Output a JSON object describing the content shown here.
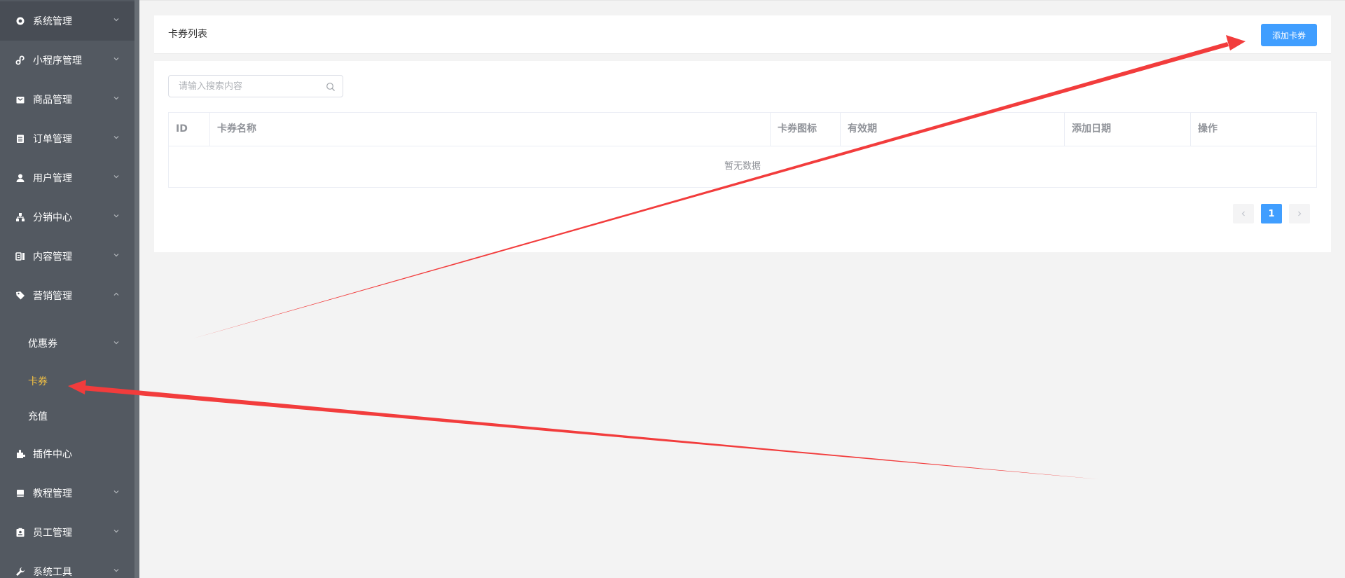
{
  "sidebar": {
    "items": [
      {
        "label": "系统管理",
        "icon": "gear-icon"
      },
      {
        "label": "小程序管理",
        "icon": "miniprogram-icon"
      },
      {
        "label": "商品管理",
        "icon": "bag-icon"
      },
      {
        "label": "订单管理",
        "icon": "order-icon"
      },
      {
        "label": "用户管理",
        "icon": "user-icon"
      },
      {
        "label": "分销中心",
        "icon": "hierarchy-icon"
      },
      {
        "label": "内容管理",
        "icon": "content-icon"
      },
      {
        "label": "营销管理",
        "icon": "tag-icon"
      }
    ],
    "sub_items": [
      {
        "label": "优惠券"
      },
      {
        "label": "卡券"
      },
      {
        "label": "充值"
      }
    ],
    "items_bottom": [
      {
        "label": "插件中心",
        "icon": "plugin-icon"
      },
      {
        "label": "教程管理",
        "icon": "tutorial-icon"
      },
      {
        "label": "员工管理",
        "icon": "staff-icon"
      },
      {
        "label": "系统工具",
        "icon": "wrench-icon"
      }
    ]
  },
  "header": {
    "title": "卡券列表",
    "add_label": "添加卡券"
  },
  "search": {
    "placeholder": "请输入搜索内容"
  },
  "table": {
    "columns": [
      "ID",
      "卡券名称",
      "卡券图标",
      "有效期",
      "添加日期",
      "操作"
    ],
    "empty_text": "暂无数据"
  },
  "pagination": {
    "current_page": "1"
  },
  "colors": {
    "sidebar_bg": "#535961",
    "active_text": "#f3c143",
    "primary": "#409eff",
    "annotation_arrow": "#f23c3c"
  }
}
